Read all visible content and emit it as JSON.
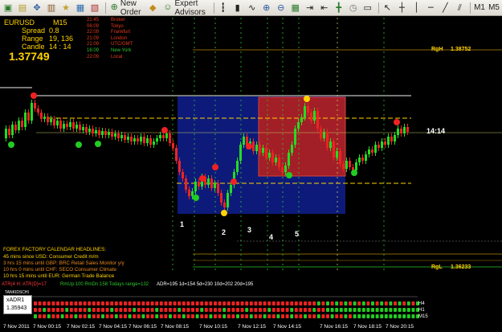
{
  "toolbar": {
    "new_order": "New Order",
    "expert_advisors": "Expert Advisors",
    "timeframes": [
      "M1",
      "M5"
    ]
  },
  "info": {
    "symbol": "EURUSD",
    "timeframe": "M15",
    "spread_label": "Spread",
    "spread_value": "0.8",
    "range_label": "Range",
    "range_value": "19, 136",
    "candle_label": "Candle",
    "candle_value": "14 : 14",
    "price": "1.37749"
  },
  "sessions": [
    {
      "time": "21:45",
      "name": "Broker",
      "color": "#e03a1e"
    },
    {
      "time": "06:09",
      "name": "Tokyo",
      "color": "#e03a1e"
    },
    {
      "time": "22:09",
      "name": "Frankfurt",
      "color": "#e03a1e"
    },
    {
      "time": "21:09",
      "name": "London",
      "color": "#e03a1e"
    },
    {
      "time": "21:09",
      "name": "UTC/GMT",
      "color": "#e03a1e"
    },
    {
      "time": "16:09",
      "name": "New York",
      "color": "#2ec52e"
    },
    {
      "time": "22:09",
      "name": "Local",
      "color": "#e03a1e"
    }
  ],
  "levels": {
    "rgh_label": "RgH",
    "rgh_value": "1.38752",
    "rgl_label": "RgL",
    "rgl_value": "1.36233",
    "candle_timer": "14:14"
  },
  "wave_labels": [
    "1",
    "2",
    "3",
    "4",
    "5"
  ],
  "news": {
    "title": "FOREX FACTORY CALENDAR HEADLINES:",
    "items": [
      {
        "text": "45 mins since USD: Consumer Credit m/m",
        "color": "#ffd200"
      },
      {
        "text": "3 hrs 15 mins until GBP: BRC Retail Sales Monitor y/y",
        "color": "#e8891c"
      },
      {
        "text": "10 hrs 0 mins until CHF: SECO Consumer Climate",
        "color": "#e8891c"
      },
      {
        "text": "10 hrs 15 mins until EUR: German Trade Balance",
        "color": "#ffd200"
      }
    ]
  },
  "stats_row": [
    {
      "text": "ATR(4 H: ATR(D)=17",
      "color": "#ff3a3a"
    },
    {
      "text": "RmUp:100  RmDn:158  Todays range=132",
      "color": "#2ec52e"
    },
    {
      "text": "ADR=195  1d=154  5d=230  10d=202  20d=195",
      "color": "#ffffff"
    }
  ],
  "xadr": {
    "name": "xADR1",
    "value": "1.35943"
  },
  "dashboard": {
    "header": "TANKIDSCHI",
    "timeframes": [
      "H4",
      "H1",
      "M15"
    ]
  },
  "time_axis": [
    "7 Nov 2011",
    "7 Nov 00:15",
    "7 Nov 02:15",
    "7 Nov 04:15",
    "7 Nov 06:15",
    "7 Nov 08:15",
    "7 Nov 10:15",
    "7 Nov 12:15",
    "7 Nov 14:15",
    "7 Nov 16:15",
    "7 Nov 18:15",
    "7 Nov 20:15"
  ],
  "colors": {
    "bull": "#22dd22",
    "bear": "#ee2222",
    "blue_box": "#0d1a7a",
    "red_box": "#b02020",
    "accent": "#ffd200"
  }
}
